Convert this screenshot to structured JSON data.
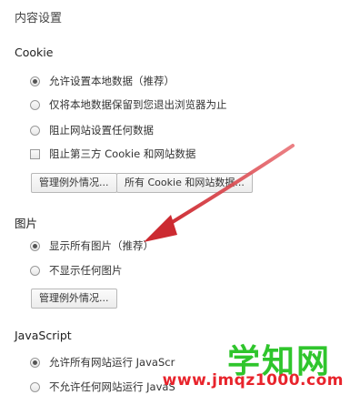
{
  "dialog": {
    "title": "内容设置"
  },
  "cookie": {
    "title": "Cookie",
    "options": [
      {
        "label": "允许设置本地数据（推荐）",
        "checked": true
      },
      {
        "label": "仅将本地数据保留到您退出浏览器为止",
        "checked": false
      },
      {
        "label": "阻止网站设置任何数据",
        "checked": false
      }
    ],
    "checkbox_label": "阻止第三方 Cookie 和网站数据",
    "buttons": {
      "manage_exceptions": "管理例外情况...",
      "all_cookies": "所有 Cookie 和网站数据..."
    }
  },
  "images": {
    "title": "图片",
    "options": [
      {
        "label": "显示所有图片（推荐）",
        "checked": true
      },
      {
        "label": "不显示任何图片",
        "checked": false
      }
    ],
    "buttons": {
      "manage_exceptions": "管理例外情况..."
    }
  },
  "javascript": {
    "title": "JavaScript",
    "options": [
      {
        "label": "允许所有网站运行 JavaScr",
        "checked": true
      },
      {
        "label": "不允许任何网站运行 JavaS",
        "checked": false
      }
    ]
  },
  "annotation": {
    "arrow_color": "#d9343b"
  },
  "watermark": {
    "logo": "学知网",
    "url": "www.jmqz1000.com"
  }
}
